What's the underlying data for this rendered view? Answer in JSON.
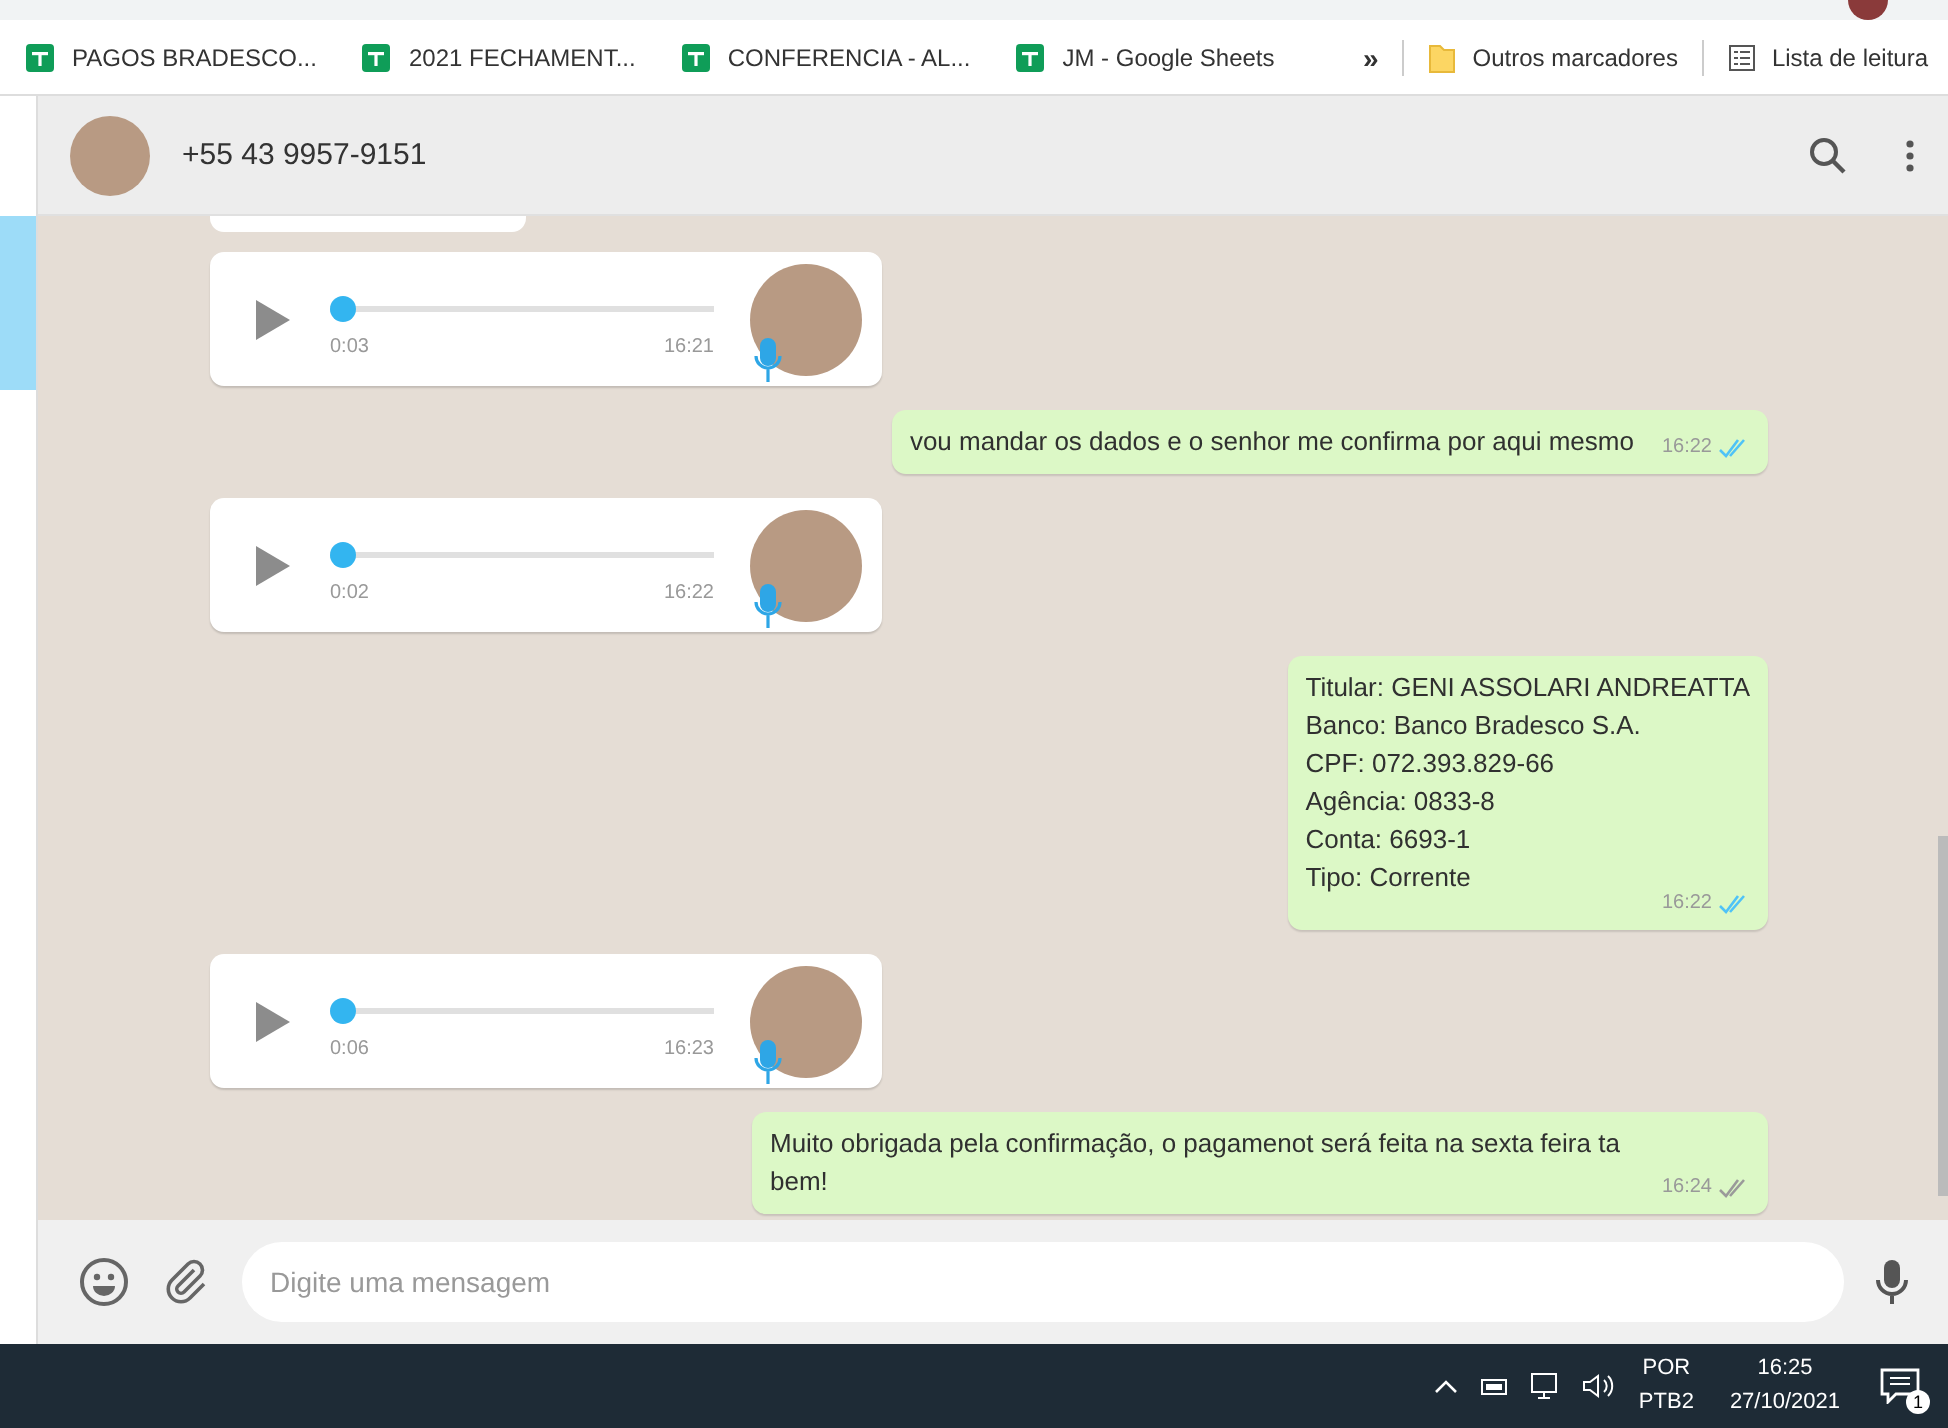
{
  "bookmarks": [
    {
      "label": "PAGOS BRADESCO...",
      "kind": "sheet"
    },
    {
      "label": "2021 FECHAMENT...",
      "kind": "sheet"
    },
    {
      "label": "CONFERENCIA - AL...",
      "kind": "sheet"
    },
    {
      "label": "JM - Google Sheets",
      "kind": "sheet"
    }
  ],
  "bookmarks_overflow": "»",
  "other_bookmarks": "Outros marcadores",
  "reading_list": "Lista de leitura",
  "chat": {
    "contact": "+55 43 9957-9151"
  },
  "messages": [
    {
      "kind": "audio",
      "duration": "0:03",
      "time": "16:21",
      "level": 0
    },
    {
      "kind": "text",
      "lines": [
        "vou mandar os dados e o senhor me confirma por aqui mesmo"
      ],
      "time": "16:22",
      "read": true
    },
    {
      "kind": "audio",
      "duration": "0:02",
      "time": "16:22",
      "level": 0
    },
    {
      "kind": "text",
      "lines": [
        "Titular: GENI ASSOLARI ANDREATTA",
        "Banco: Banco Bradesco S.A.",
        "CPF: 072.393.829-66",
        "Agência: 0833-8",
        "Conta: 6693-1",
        "Tipo: Corrente"
      ],
      "time": "16:22",
      "read": true
    },
    {
      "kind": "audio",
      "duration": "0:06",
      "time": "16:23",
      "level": 0
    },
    {
      "kind": "text",
      "lines": [
        "Muito obrigada pela confirmação, o pagamenot será feita na sexta feira ta bem!"
      ],
      "time": "16:24",
      "read": false
    }
  ],
  "composer": {
    "placeholder": "Digite uma mensagem"
  },
  "taskbar": {
    "language": "POR",
    "layout": "PTB2",
    "time": "16:25",
    "date": "27/10/2021",
    "notifications": "1"
  }
}
